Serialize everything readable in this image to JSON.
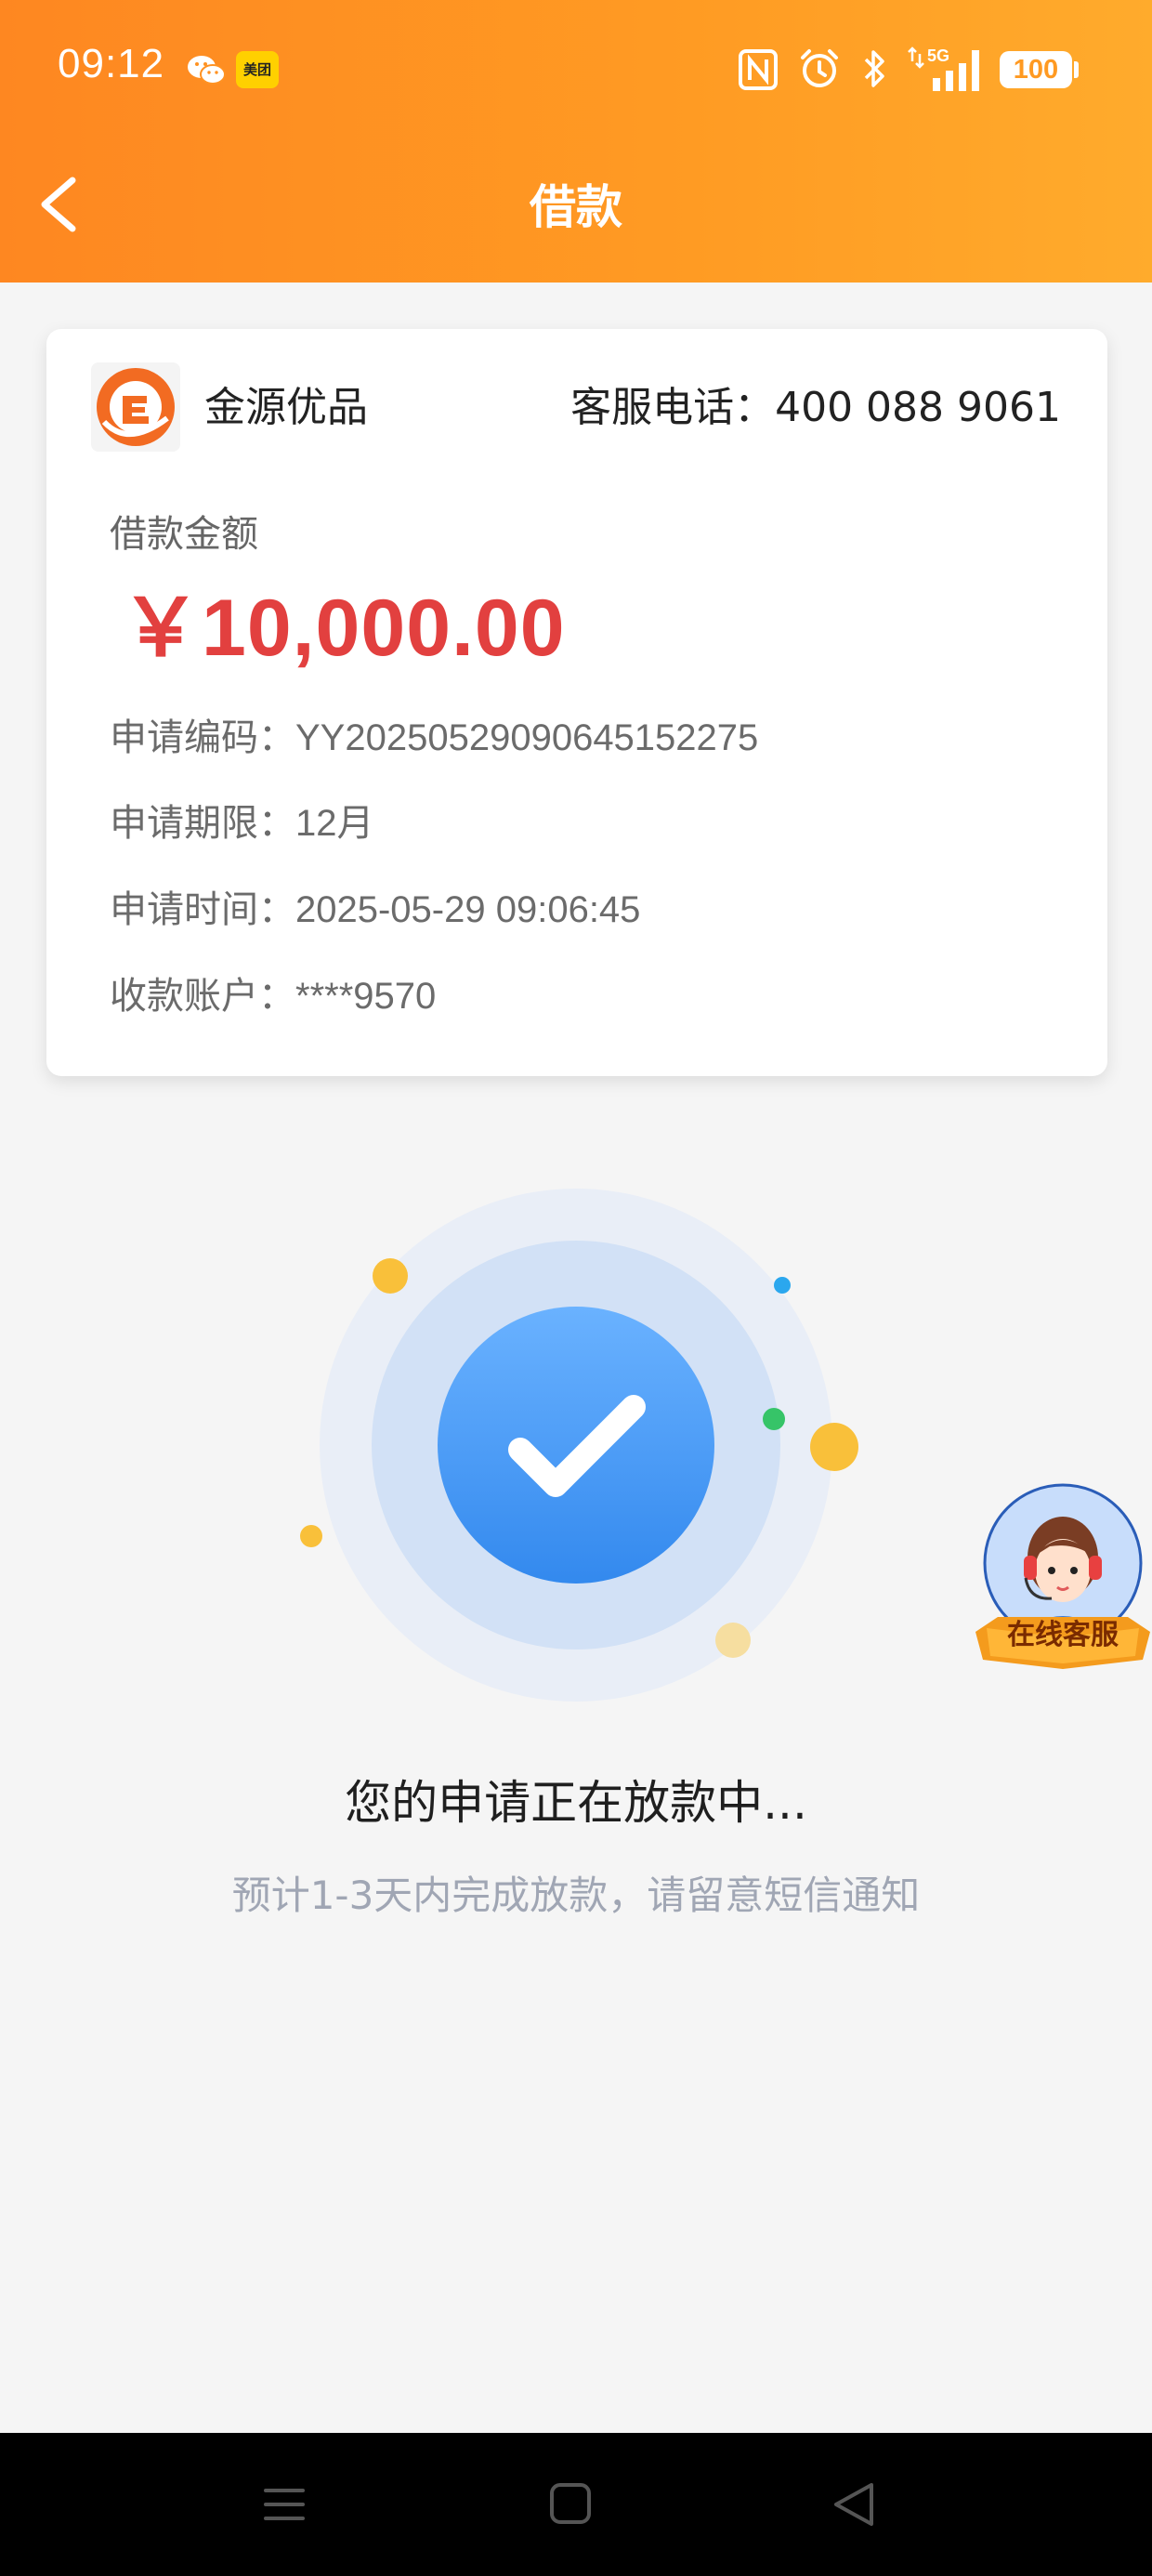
{
  "status_bar": {
    "time": "09:12",
    "meituan_label": "美团",
    "signal_label": "5G",
    "battery": "100",
    "icons": [
      "wechat-icon",
      "meituan-icon",
      "nfc-icon",
      "alarm-icon",
      "bluetooth-icon",
      "signal-icon",
      "battery-icon"
    ]
  },
  "header": {
    "title": "借款",
    "back_icon": "chevron-left-icon"
  },
  "card": {
    "merchant_name": "金源优品",
    "service_phone": "客服电话：400 088 9061",
    "amount_label": "借款金额",
    "amount": "￥10,000.00",
    "rows": [
      {
        "key": "申请编码：",
        "value": "YY2025052909064515 2275"
      },
      {
        "key": "申请期限：",
        "value": "12月"
      },
      {
        "key": "申请时间：",
        "value": "2025-05-29 09:06:45"
      },
      {
        "key": "收款账户：",
        "value": "****9570"
      }
    ]
  },
  "status": {
    "main": "您的申请正在放款中...",
    "sub": "预计1-3天内完成放款，请留意短信通知"
  },
  "floating_service": {
    "label": "在线客服"
  },
  "nav_bar": {
    "icons": [
      "menu-icon",
      "home-icon",
      "back-triangle-icon"
    ]
  },
  "colors": {
    "header_start": "#fe8721",
    "header_end": "#ffab2c",
    "amount_red": "#e2403f",
    "check_blue": "#3d8ff0",
    "sub_text": "#a0a6b4"
  }
}
